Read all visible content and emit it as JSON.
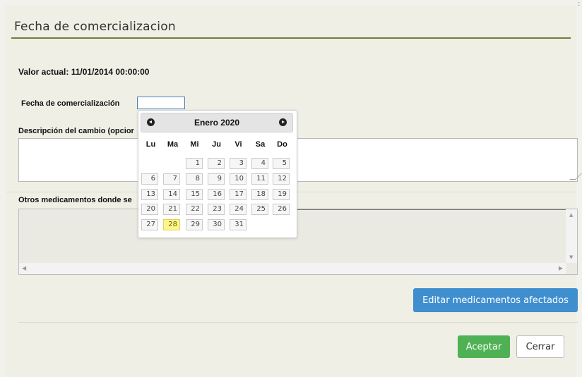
{
  "dialog": {
    "title": "Fecha de comercializacion",
    "valor_actual": "Valor actual: 11/01/2014 00:00:00",
    "fecha_label": "Fecha de comercialización",
    "fecha_value": "",
    "descripcion_label": "Descripción del cambio (opcior",
    "otros_label": "Otros medicamentos donde se",
    "edit_button": "Editar medicamentos afectados",
    "accept_button": "Aceptar",
    "close_button": "Cerrar",
    "corner_mark": ":"
  },
  "datepicker": {
    "title": "Enero 2020",
    "weekdays": [
      "Lu",
      "Ma",
      "Mi",
      "Ju",
      "Vi",
      "Sa",
      "Do"
    ],
    "weeks": [
      [
        "",
        "",
        "1",
        "2",
        "3",
        "4",
        "5"
      ],
      [
        "6",
        "7",
        "8",
        "9",
        "10",
        "11",
        "12"
      ],
      [
        "13",
        "14",
        "15",
        "16",
        "17",
        "18",
        "19"
      ],
      [
        "20",
        "21",
        "22",
        "23",
        "24",
        "25",
        "26"
      ],
      [
        "27",
        "28",
        "29",
        "30",
        "31",
        "",
        ""
      ]
    ],
    "today": "28",
    "prev_icon": "prev-circle-icon",
    "next_icon": "next-circle-icon"
  },
  "colors": {
    "title_rule": "#6f7f3a",
    "edit_button": "#3f8fcf",
    "accept_button": "#4fb154",
    "today_highlight": "#fbf58e"
  }
}
